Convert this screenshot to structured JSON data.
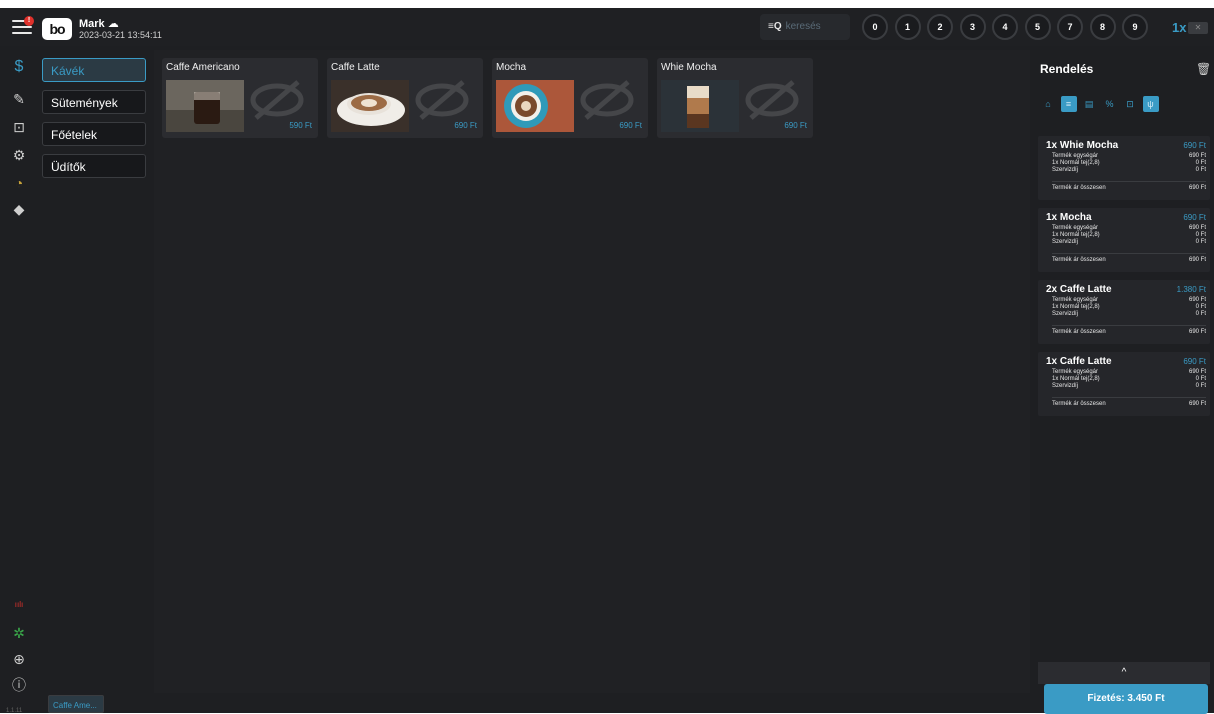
{
  "header": {
    "user": "Mark",
    "datetime": "2023-03-21  13:54:11",
    "notification": "!",
    "logo_text": "bo",
    "search_placeholder": "keresés",
    "numpad": [
      "0",
      "1",
      "2",
      "3",
      "4",
      "5",
      "7",
      "8",
      "9"
    ],
    "multiplier": "1x"
  },
  "rail": {
    "icons": [
      "dollar-icon",
      "edit-icon",
      "bag-icon",
      "settings-icon",
      "clock-icon",
      "tag-icon"
    ],
    "bottom_icons": [
      "signal-icon",
      "network-icon",
      "globe-icon",
      "info-icon"
    ]
  },
  "categories": [
    {
      "label": "Kávék",
      "active": true
    },
    {
      "label": "Sütemények",
      "active": false
    },
    {
      "label": "Főételek",
      "active": false
    },
    {
      "label": "Üdítők",
      "active": false
    }
  ],
  "products": [
    {
      "name": "Caffe Americano",
      "price": "590 Ft"
    },
    {
      "name": "Caffe Latte",
      "price": "690 Ft"
    },
    {
      "name": "Mocha",
      "price": "690 Ft"
    },
    {
      "name": "Whie Mocha",
      "price": "690 Ft"
    }
  ],
  "order": {
    "title": "Rendelés",
    "items": [
      {
        "name": "1x Whie Mocha",
        "price": "690 Ft",
        "unit_label": "Termék egységár",
        "unit": "690 Ft",
        "option_label": "1x Normál tej(2,8)",
        "option": "0 Ft",
        "service_label": "Szervizdíj",
        "service": "0 Ft",
        "total_label": "Termék ár összesen",
        "total": "690 Ft"
      },
      {
        "name": "1x Mocha",
        "price": "690 Ft",
        "unit_label": "Termék egységár",
        "unit": "690 Ft",
        "option_label": "1x Normál tej(2,8)",
        "option": "0 Ft",
        "service_label": "Szervizdíj",
        "service": "0 Ft",
        "total_label": "Termék ár összesen",
        "total": "690 Ft"
      },
      {
        "name": "2x Caffe Latte",
        "price": "1.380 Ft",
        "unit_label": "Termék egységár",
        "unit": "690 Ft",
        "option_label": "1x Normál tej(2,8)",
        "option": "0 Ft",
        "service_label": "Szervizdíj",
        "service": "0 Ft",
        "total_label": "Termék ár összesen",
        "total": "690 Ft"
      },
      {
        "name": "1x Caffe Latte",
        "price": "690 Ft",
        "unit_label": "Termék egységár",
        "unit": "690 Ft",
        "option_label": "1x Normál tej(2,8)",
        "option": "0 Ft",
        "service_label": "Szervizdíj",
        "service": "0 Ft",
        "total_label": "Termék ár összesen",
        "total": "690 Ft"
      }
    ],
    "pay_label": "Fizetés: 3.450 Ft",
    "expand_symbol": "^"
  },
  "bottom": {
    "tab_label": "Caffe Ame...",
    "version": "1.1.11"
  },
  "colors": {
    "accent": "#3a9bc5",
    "background": "#1e1f22",
    "panel": "#2b2c30",
    "alert": "#e0312b"
  }
}
